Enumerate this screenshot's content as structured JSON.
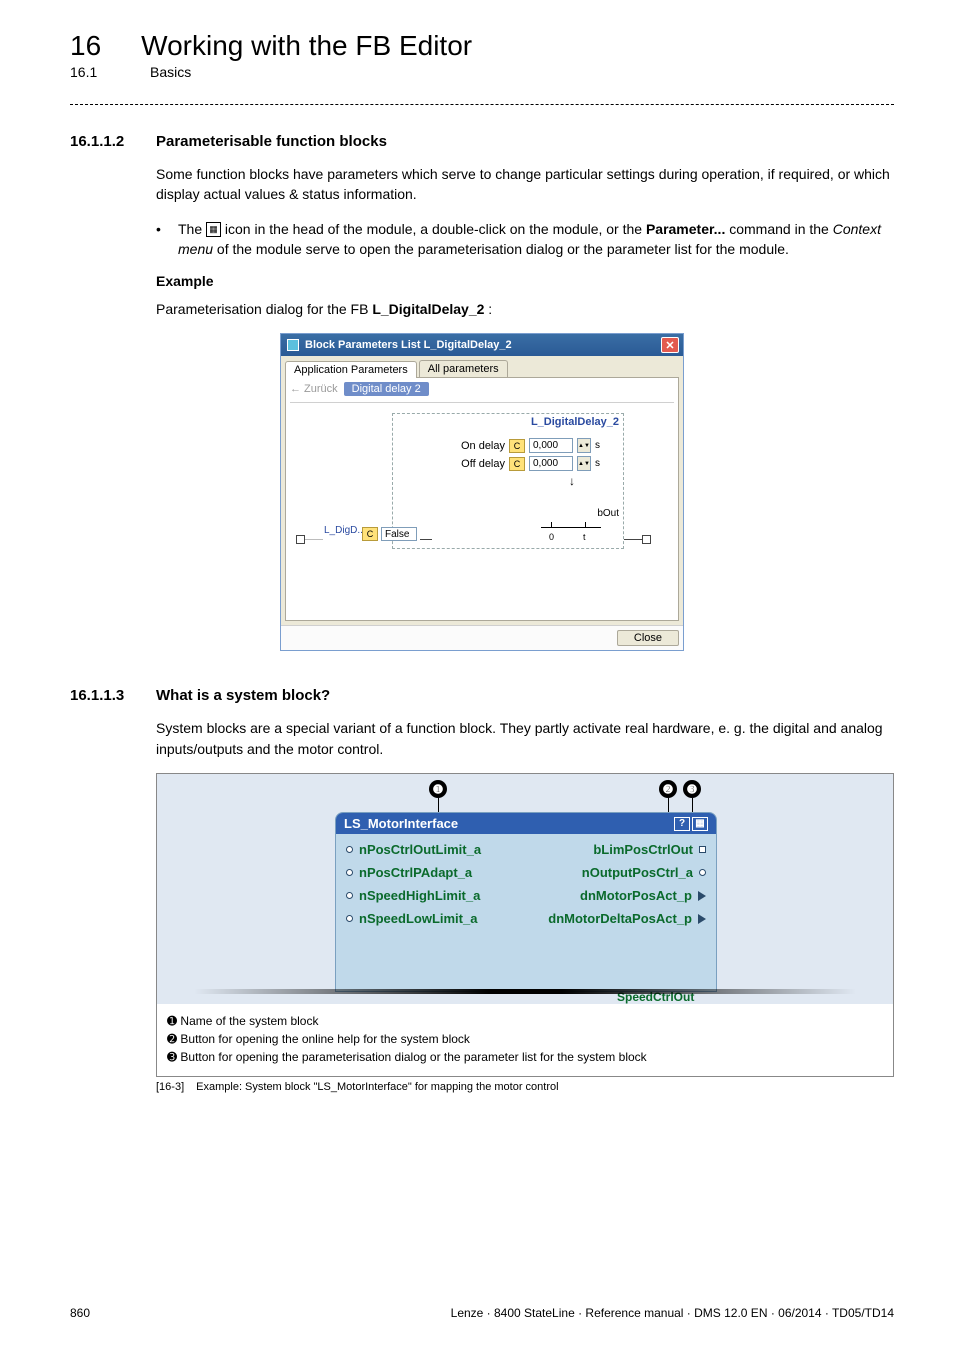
{
  "chapter": {
    "number": "16",
    "title": "Working with the FB Editor"
  },
  "section": {
    "number": "16.1",
    "title": "Basics"
  },
  "sub1": {
    "number": "16.1.1.2",
    "title": "Parameterisable function blocks",
    "para1": "Some function blocks have parameters which serve to change particular settings during operation, if required, or which display actual values & status information.",
    "bullet_pre": "The ",
    "bullet_mid": " icon in the head of the module, a double-click on the module, or the ",
    "bullet_bold": "Parameter...",
    "bullet_post1": " command in the ",
    "bullet_italic": "Context menu",
    "bullet_post2": " of the module serve to open the parameterisation dialog or the parameter list for the module.",
    "example_label": "Example",
    "example_line_pre": "Parameterisation dialog for the FB ",
    "example_line_bold": "L_DigitalDelay_2",
    "example_line_post": ":"
  },
  "dialog": {
    "title": "Block Parameters List L_DigitalDelay_2",
    "tabs": [
      "Application Parameters",
      "All parameters"
    ],
    "back": "Zurück",
    "back_tab": "Digital delay 2",
    "fb_name": "L_DigitalDelay_2",
    "on_delay_label": "On delay",
    "off_delay_label": "Off delay",
    "on_delay_value": "0,000",
    "off_delay_value": "0,000",
    "delay_unit": "s",
    "c_btn": "C",
    "sig_in_name": "L_DigD..",
    "sig_in_value": "False",
    "b_out": "bOut",
    "t0": "0",
    "tt": "t",
    "close": "Close"
  },
  "sub2": {
    "number": "16.1.1.3",
    "title": "What is a system block?",
    "para": "System blocks are a special variant of a function block. They partly activate real hardware, e. g. the digital and analog inputs/outputs and the motor control."
  },
  "sb": {
    "name": "LS_MotorInterface",
    "help_icon": "?",
    "inputs": [
      "nPosCtrlOutLimit_a",
      "nPosCtrlPAdapt_a",
      "nSpeedHighLimit_a",
      "nSpeedLowLimit_a"
    ],
    "outputs": [
      "bLimPosCtrlOut",
      "nOutputPosCtrl_a",
      "dnMotorPosAct_p",
      "dnMotorDeltaPosAct_p"
    ],
    "cut_output": "SpeedCtrlOut",
    "notes": {
      "n1": "Name of the system block",
      "n2": "Button for opening the online help for the system block",
      "n3": "Button for opening the parameterisation dialog or the parameter list for the system block"
    }
  },
  "caption": {
    "ref": "[16-3]",
    "text": "Example: System block \"LS_MotorInterface\" for mapping the motor control"
  },
  "footer": {
    "page": "860",
    "info": "Lenze · 8400 StateLine · Reference manual · DMS 12.0 EN · 06/2014 · TD05/TD14"
  }
}
